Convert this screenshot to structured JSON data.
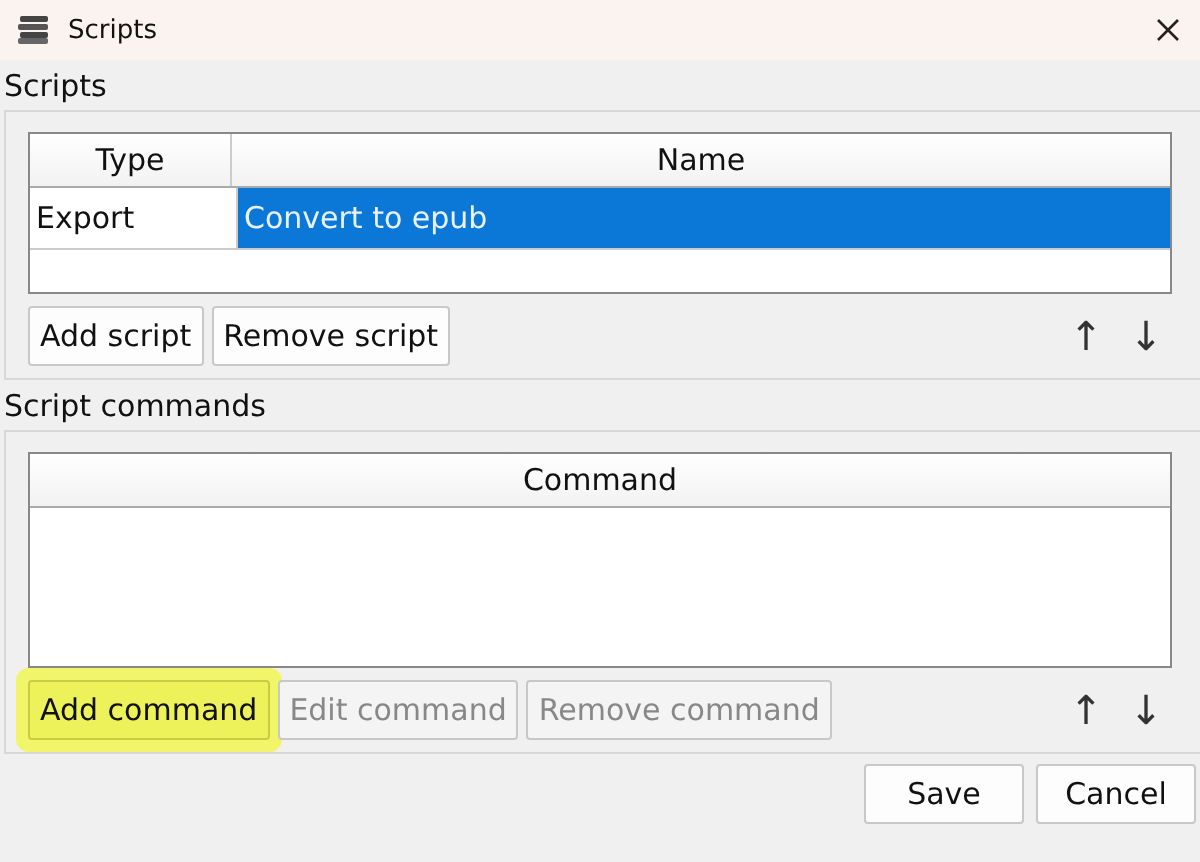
{
  "window": {
    "title": "Scripts"
  },
  "scripts": {
    "label": "Scripts",
    "columns": [
      "Type",
      "Name"
    ],
    "rows": [
      {
        "cells": [
          "Export",
          "Convert to epub"
        ],
        "selected": true
      }
    ],
    "buttons": [
      {
        "label": "Add script",
        "disabled": false,
        "highlighted": false
      },
      {
        "label": "Remove script",
        "disabled": false,
        "highlighted": false
      }
    ],
    "move_up": "↑",
    "move_down": "↓"
  },
  "commands": {
    "label": "Script commands",
    "columns": [
      "Command"
    ],
    "buttons": [
      {
        "label": "Add command",
        "disabled": false,
        "highlighted": true
      },
      {
        "label": "Edit command",
        "disabled": true,
        "highlighted": false
      },
      {
        "label": "Remove command",
        "disabled": true,
        "highlighted": false
      }
    ],
    "move_up": "↑",
    "move_down": "↓"
  },
  "footer_buttons": [
    "Save",
    "Cancel"
  ]
}
